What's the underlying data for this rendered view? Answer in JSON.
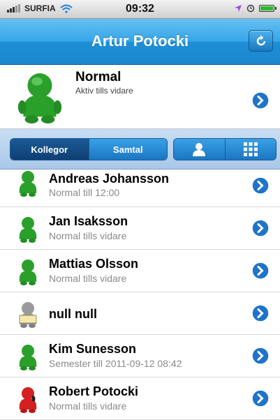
{
  "status_bar": {
    "carrier": "SURFIA",
    "time": "09:32"
  },
  "nav": {
    "title": "Artur Potocki",
    "refresh_icon": "refresh-icon"
  },
  "my_status": {
    "title": "Normal",
    "subtitle": "Aktiv tills vidare",
    "avatar_color": "#2aa02a"
  },
  "segments": {
    "left": [
      "Kollegor",
      "Samtal"
    ],
    "active": "Kollegor",
    "right_icons": [
      "person-icon",
      "keypad-icon"
    ]
  },
  "contacts": [
    {
      "name": "Andreas Johansson",
      "status": "Normal till 12:00",
      "color": "#2aa02a"
    },
    {
      "name": "Jan Isaksson",
      "status": "Normal tills vidare",
      "color": "#2aa02a"
    },
    {
      "name": "Mattias Olsson",
      "status": "Normal tills vidare",
      "color": "#2aa02a"
    },
    {
      "name": "null null",
      "status": "",
      "color": "#9a9a9a"
    },
    {
      "name": "Kim Sunesson",
      "status": "Semester till 2011-09-12 08:42",
      "color": "#2aa02a"
    },
    {
      "name": "Robert Potocki",
      "status": "Normal tills vidare",
      "color": "#d42020"
    }
  ],
  "colors": {
    "nav_blue": "#2a9be0",
    "chevron_blue": "#1f74c9"
  }
}
